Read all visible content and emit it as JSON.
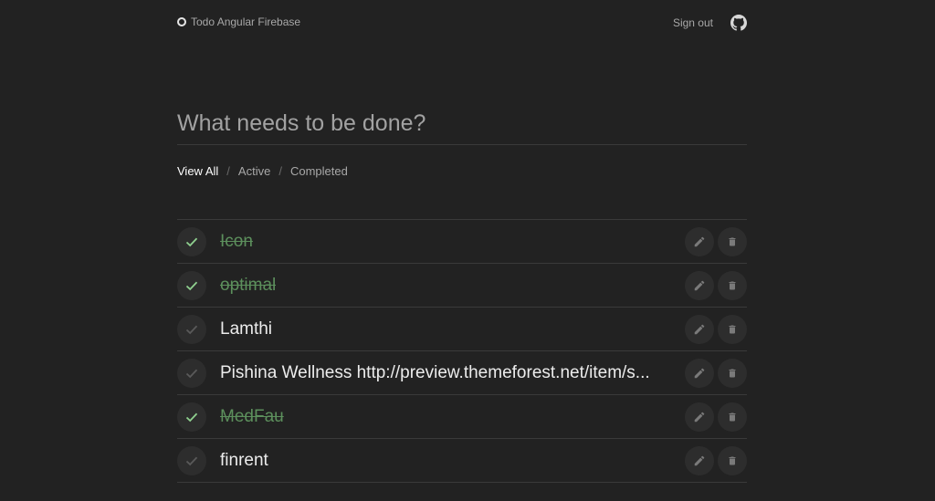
{
  "header": {
    "brand_title": "Todo Angular Firebase",
    "sign_out_label": "Sign out"
  },
  "new_todo": {
    "placeholder": "What needs to be done?"
  },
  "filters": [
    {
      "label": "View All",
      "active": true
    },
    {
      "label": "Active",
      "active": false
    },
    {
      "label": "Completed",
      "active": false
    }
  ],
  "todos": [
    {
      "title": "Icon",
      "completed": true
    },
    {
      "title": "optimal",
      "completed": true
    },
    {
      "title": "Lamthi",
      "completed": false
    },
    {
      "title": "Pishina Wellness http://preview.themeforest.net/item/s...",
      "completed": false
    },
    {
      "title": "MedFau",
      "completed": true
    },
    {
      "title": "finrent",
      "completed": false
    }
  ],
  "colors": {
    "background": "#222222",
    "check_done": "#8fd08f",
    "check_undone": "#5a5a5a",
    "completed_text": "#5c8f5c"
  }
}
